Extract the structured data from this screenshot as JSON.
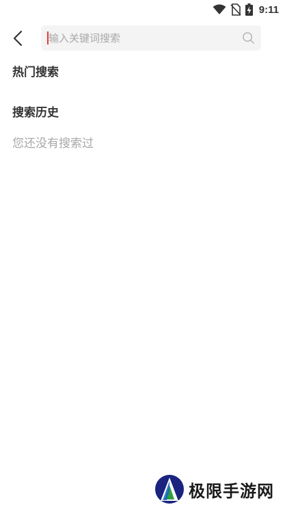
{
  "status_bar": {
    "time": "9:11",
    "icons": [
      "wifi-icon",
      "no-sim-icon",
      "battery-charging-icon"
    ]
  },
  "header": {
    "back_icon": "chevron-left-icon",
    "search": {
      "placeholder": "输入关键词搜索",
      "value": "",
      "icon": "search-icon"
    }
  },
  "hot_search": {
    "title": "热门搜索"
  },
  "history": {
    "title": "搜索历史",
    "empty_text": "您还没有搜索过"
  },
  "watermark": {
    "text": "极限手游网"
  },
  "colors": {
    "caret": "#e53935",
    "text_primary": "#333333",
    "text_secondary": "#a8a8a8",
    "search_bg": "#f4f4f4"
  }
}
